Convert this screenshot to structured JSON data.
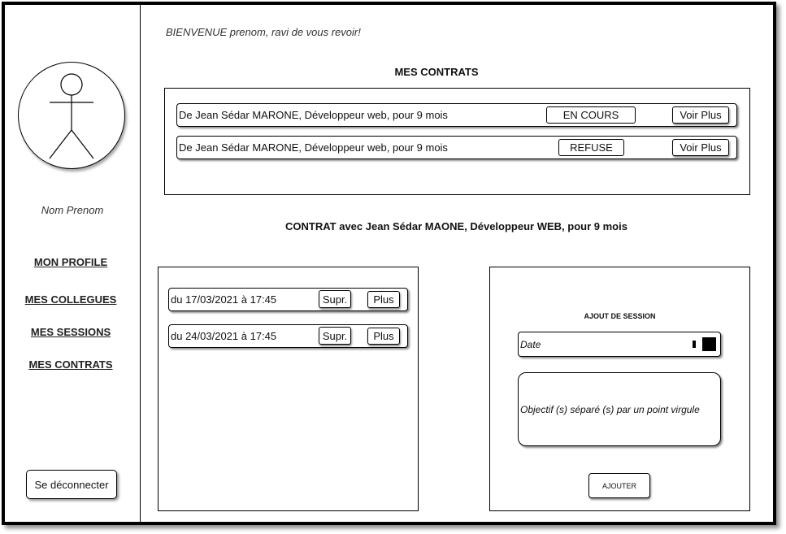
{
  "sidebar": {
    "user_name": "Nom Prenom",
    "nav": [
      "MON PROFILE",
      "MES COLLEGUES",
      "MES SESSIONS",
      "MES CONTRATS"
    ],
    "logout_label": "Se déconnecter"
  },
  "header": {
    "welcome": "BIENVENUE prenom, ravi de vous revoir!"
  },
  "contracts": {
    "title": "MES CONTRATS",
    "items": [
      {
        "description": "De Jean Sédar MARONE, Développeur web, pour 9 mois",
        "status": "EN COURS",
        "action": "Voir Plus"
      },
      {
        "description": "De Jean Sédar MARONE, Développeur web, pour 9 mois",
        "status": "REFUSE",
        "action": "Voir Plus"
      }
    ]
  },
  "contract_detail": {
    "title": "CONTRAT avec Jean Sédar MAONE, Développeur WEB, pour 9 mois"
  },
  "sessions": {
    "items": [
      {
        "label": "du 17/03/2021 à 17:45",
        "delete": "Supr.",
        "more": "Plus"
      },
      {
        "label": "du 24/03/2021 à 17:45",
        "delete": "Supr.",
        "more": "Plus"
      }
    ]
  },
  "add_session": {
    "title": "AJOUT DE SESSION",
    "date_placeholder": "Date",
    "objectives_placeholder": "Objectif (s) séparé (s) par un point virgule",
    "submit_label": "AJOUTER"
  },
  "icons": {
    "avatar": "stick-figure-icon",
    "date_picker": "calendar-icon"
  },
  "colors": {
    "border": "#000000",
    "background": "#ffffff"
  }
}
